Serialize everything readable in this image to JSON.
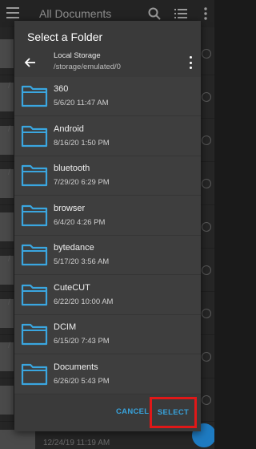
{
  "app_bar": {
    "title": "All Documents",
    "icons": [
      "menu-icon",
      "search-icon",
      "list-view-icon",
      "more-vert-icon"
    ]
  },
  "background": {
    "list_row_prefix": "/",
    "bottom_date": "12/24/19 11:19 AM"
  },
  "dialog": {
    "title": "Select a Folder",
    "storage_name": "Local Storage",
    "storage_path": "/storage/emulated/0",
    "folders": [
      {
        "name": "360",
        "date": "5/6/20 11:47 AM"
      },
      {
        "name": "Android",
        "date": "8/16/20 1:50 PM"
      },
      {
        "name": "bluetooth",
        "date": "7/29/20 6:29 PM"
      },
      {
        "name": "browser",
        "date": "6/4/20 4:26 PM"
      },
      {
        "name": "bytedance",
        "date": "5/17/20 3:56 AM"
      },
      {
        "name": "CuteCUT",
        "date": "6/22/20 10:00 AM"
      },
      {
        "name": "DCIM",
        "date": "6/15/20 7:43 PM"
      },
      {
        "name": "Documents",
        "date": "6/26/20 5:43 PM"
      }
    ],
    "cancel_label": "CANCEL",
    "select_label": "SELECT"
  },
  "colors": {
    "accent": "#38a3dc",
    "highlight": "#e01818",
    "folder": "#3aa6e0"
  }
}
